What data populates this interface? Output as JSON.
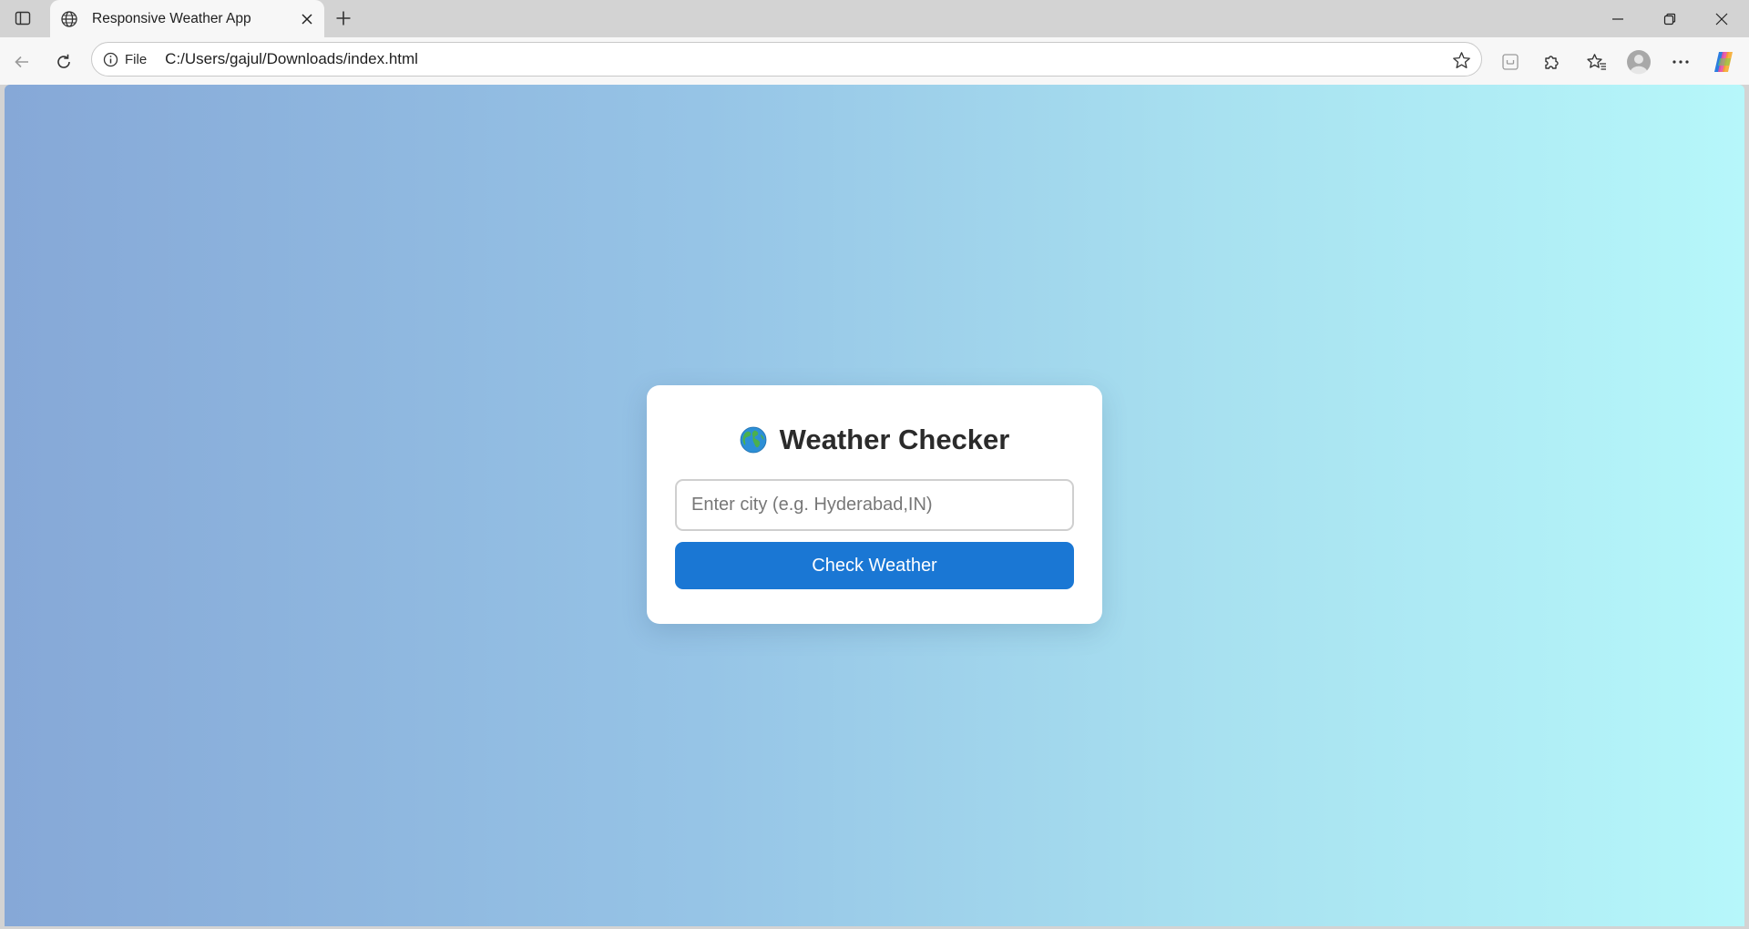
{
  "tab": {
    "title": "Responsive Weather App"
  },
  "address_bar": {
    "scheme_label": "File",
    "url": "C:/Users/gajul/Downloads/index.html"
  },
  "app": {
    "heading": "Weather Checker",
    "city_input": {
      "value": "",
      "placeholder": "Enter city (e.g. Hyderabad,IN)"
    },
    "button_label": "Check Weather"
  },
  "icons": {
    "tab_actions": "tab-actions-icon",
    "favicon": "globe-icon",
    "tab_close": "close-icon",
    "new_tab": "plus-icon",
    "minimize": "minimize-icon",
    "restore": "restore-icon",
    "window_close": "close-icon",
    "back": "back-arrow-icon",
    "reload": "reload-icon",
    "site_info": "info-icon",
    "favorite": "star-icon",
    "split_screen": "split-screen-icon",
    "extensions": "puzzle-icon",
    "favorites": "favorites-icon",
    "profile": "avatar-icon",
    "more": "more-icon",
    "copilot": "copilot-icon",
    "heading_emoji": "earth-globe-icon"
  },
  "colors": {
    "button": "#1a77d4",
    "background_start": "#86a8d7",
    "background_end": "#b6f7fa",
    "card": "#ffffff"
  }
}
